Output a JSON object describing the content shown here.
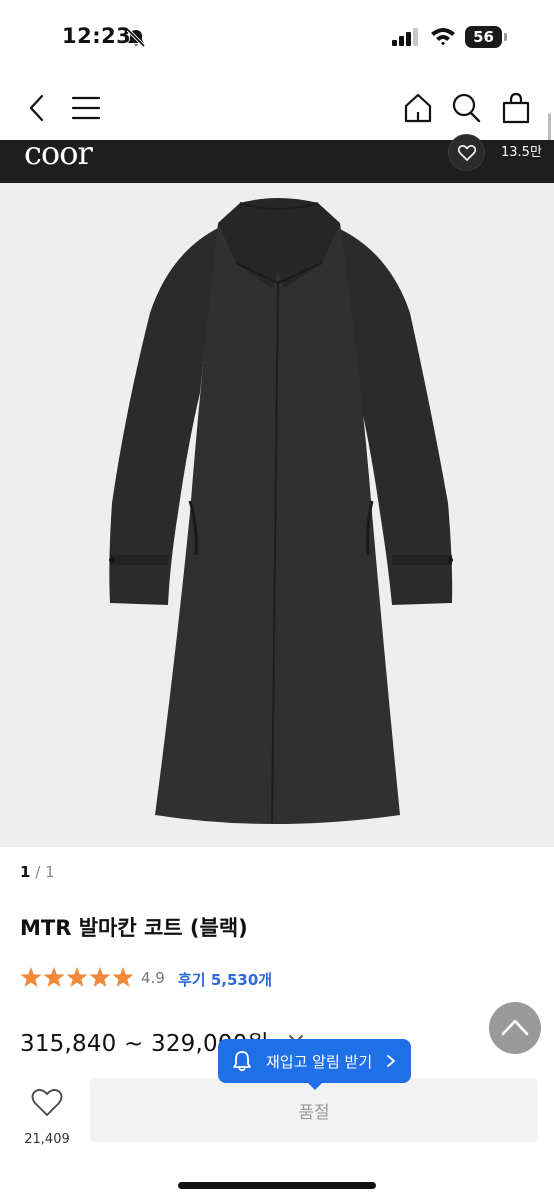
{
  "status_bar": {
    "time": "12:23",
    "battery_level": "56",
    "icons": [
      "bell-slash-icon",
      "cellular-signal-icon",
      "wifi-icon",
      "battery-icon"
    ]
  },
  "nav": {
    "icons": [
      "chevron-left-icon",
      "hamburger-menu-icon",
      "home-icon",
      "search-icon",
      "shopping-bag-icon"
    ]
  },
  "brand": {
    "logo_text": "coor",
    "like_count": "13.5만"
  },
  "gallery": {
    "current": "1",
    "separator": "/",
    "total": "1"
  },
  "product": {
    "title": "MTR 발마칸 코트 (블랙)",
    "rating_stars": 5,
    "rating_value": "4.9",
    "review_link": "후기 5,530개",
    "price": "315,840 ~ 329,000원"
  },
  "tooltip": {
    "text": "재입고 알림 받기"
  },
  "bottom_bar": {
    "wish_count": "21,409",
    "soldout_label": "품절"
  },
  "colors": {
    "accent_blue": "#1f6fe8",
    "star_orange": "#f08a3a",
    "review_blue": "#2e6bd8",
    "brand_strip": "#1e1e1e"
  }
}
